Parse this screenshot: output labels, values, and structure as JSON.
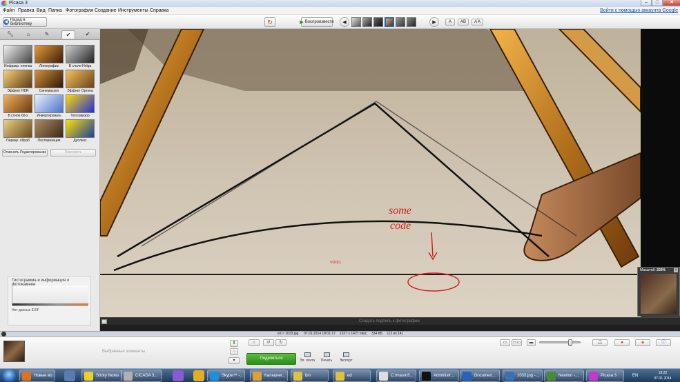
{
  "window": {
    "title": "Picasa 3",
    "app_icon": "picasa-icon"
  },
  "menu": {
    "items": [
      "Файл",
      "Правка",
      "Вид",
      "Папка",
      "Фотография",
      "Создание",
      "Инструменты",
      "Справка"
    ],
    "login_link": "Войти с помощью аккаунта Google"
  },
  "toolbar": {
    "back_label": "Назад в библиотеку",
    "play_label": "Воспроизвести",
    "caption_modes": [
      "A",
      "AB",
      "A A"
    ]
  },
  "tools_tabs": [
    "wrench-icon",
    "sun-icon",
    "brush-icon",
    "effects-icon",
    "effects2-icon"
  ],
  "effects": [
    {
      "label": "Инфракр. пленка",
      "colors": [
        "#f0f0f0",
        "#444"
      ]
    },
    {
      "label": "Лопографиz",
      "colors": [
        "#e69a3a",
        "#3a1e0a"
      ]
    },
    {
      "label": "В стиле Holga",
      "colors": [
        "#cfcfcf",
        "#222"
      ]
    },
    {
      "label": "Эффект HDR",
      "colors": [
        "#f7d07a",
        "#5a3a12"
      ]
    },
    {
      "label": "Синемаскоп",
      "colors": [
        "#d98e3a",
        "#2a1a0a"
      ]
    },
    {
      "label": "Эффект Ортона",
      "colors": [
        "#f4c060",
        "#6a4418"
      ]
    },
    {
      "label": "В стиле 60-х",
      "colors": [
        "#f2b05a",
        "#6a3a10"
      ]
    },
    {
      "label": "Инвертировать",
      "colors": [
        "#eaf2ff",
        "#4a70c8"
      ]
    },
    {
      "label": "Тепловизор",
      "colors": [
        "#ffd800",
        "#2030e0"
      ]
    },
    {
      "label": "Перекр. обраб",
      "colors": [
        "#e8d080",
        "#6a4a20"
      ]
    },
    {
      "label": "Постеризация",
      "colors": [
        "#b08a60",
        "#3a2a1a"
      ]
    },
    {
      "label": "Дуплекс",
      "colors": [
        "#ffe000",
        "#1a40a0"
      ]
    }
  ],
  "panel_buttons": {
    "undo": "Отменить Редактирование",
    "redo": "Повторить"
  },
  "histogram": {
    "title": "Гистограмма и информация о фотокамере",
    "exif": "Нет данных EXIF"
  },
  "image_annotations": {
    "handwriting_lines": [
      "some",
      "code"
    ],
    "small_text": "VOOO.."
  },
  "minimap": {
    "label": "Масштаб:",
    "zoom": "220%"
  },
  "caption_placeholder": "Создать подпись к фотографии",
  "info": {
    "file": "ed > 1033.jpg",
    "date": "07.01.2014 18:01:17",
    "dimensions": "1327 x 1427 пикс.",
    "size": "334 КБ",
    "position": "(12 из 14)"
  },
  "tray": {
    "selected_label": "Выбранные элементы",
    "share_label": "Поделиться",
    "actions": [
      "Эл. почта",
      "Печать",
      "Экспорт"
    ],
    "zoom_level": 0.75
  },
  "taskbar": {
    "tasks": [
      "Новые во...",
      "Sticky Notes",
      "CICADA 3...",
      "Skype™ -...",
      "Калашни...",
      "bin",
      "ed",
      "C:\\masm3...",
      "Administr...",
      "Documen...",
      "1033.jpg -...",
      "Newton -...",
      "Picasa 3"
    ],
    "lang": "EN",
    "time": "19:22",
    "date": "07.01.2014"
  },
  "colors": {
    "share_green": "#2b8d1a",
    "accent_blue": "#1a4fa8",
    "annotation_red": "#d42020"
  }
}
